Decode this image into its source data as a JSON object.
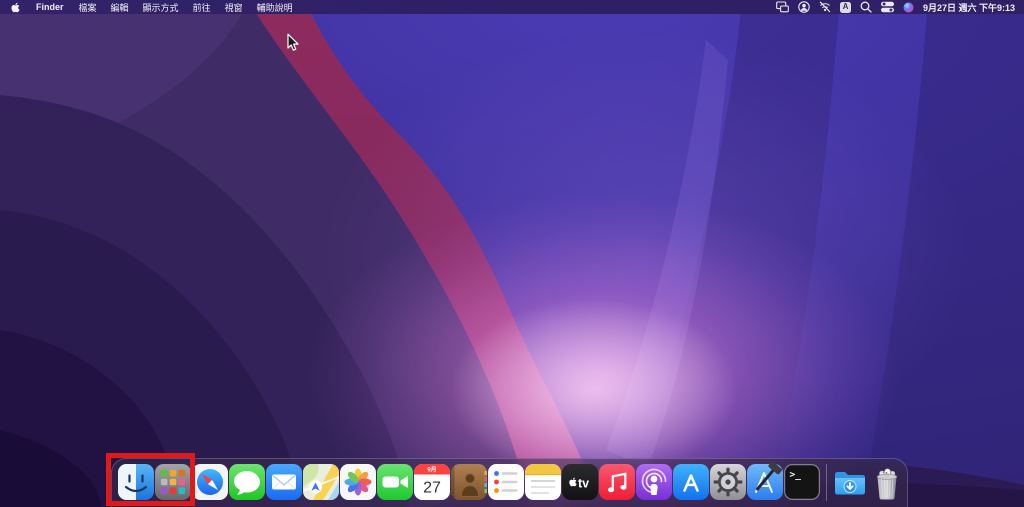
{
  "menubar": {
    "app_name": "Finder",
    "menus": [
      "檔案",
      "編輯",
      "顯示方式",
      "前往",
      "視窗",
      "輔助說明"
    ],
    "status_icons": [
      "screen-mirroring",
      "user-account",
      "wifi-off",
      "input-source",
      "spotlight-search",
      "control-center",
      "siri"
    ],
    "input_source_label": "A",
    "clock": "9月27日 週六 下午9:13"
  },
  "dock": {
    "items": [
      {
        "label": "Finder"
      },
      {
        "label": "Launchpad"
      },
      {
        "label": "Safari"
      },
      {
        "label": "Messages"
      },
      {
        "label": "Mail"
      },
      {
        "label": "Maps"
      },
      {
        "label": "Photos"
      },
      {
        "label": "FaceTime"
      },
      {
        "label": "Calendar"
      },
      {
        "label": "Contacts"
      },
      {
        "label": "Reminders"
      },
      {
        "label": "Notes"
      },
      {
        "label": "TV"
      },
      {
        "label": "Music"
      },
      {
        "label": "Podcasts"
      },
      {
        "label": "App Store"
      },
      {
        "label": "System Preferences"
      },
      {
        "label": "Xcode"
      },
      {
        "label": "Terminal"
      }
    ],
    "trailing_items": [
      {
        "label": "Downloads"
      },
      {
        "label": "Trash"
      }
    ],
    "calendar_month": "9月",
    "calendar_day": "27",
    "tv_label": "tv",
    "terminal_prompt": ">_"
  },
  "annotation": {
    "color": "#e01a1a"
  }
}
